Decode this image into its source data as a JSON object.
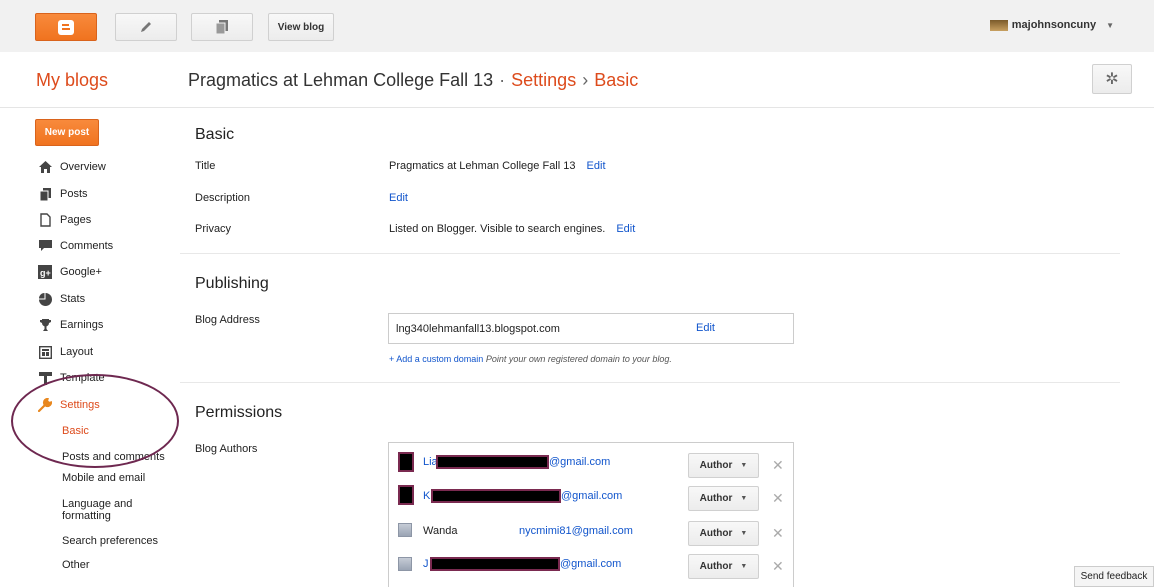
{
  "topbar": {
    "view_blog": "View blog",
    "username": "majohnsoncuny"
  },
  "header": {
    "my_blogs": "My blogs",
    "blog_name": "Pragmatics at Lehman College Fall 13",
    "sep1": "·",
    "settings": "Settings",
    "sep2": "›",
    "basic": "Basic"
  },
  "sidebar": {
    "new_post": "New post",
    "items": [
      {
        "label": "Overview",
        "icon": "home-icon"
      },
      {
        "label": "Posts",
        "icon": "posts-icon"
      },
      {
        "label": "Pages",
        "icon": "pages-icon"
      },
      {
        "label": "Comments",
        "icon": "comments-icon"
      },
      {
        "label": "Google+",
        "icon": "google-plus-icon"
      },
      {
        "label": "Stats",
        "icon": "stats-icon"
      },
      {
        "label": "Earnings",
        "icon": "trophy-icon"
      },
      {
        "label": "Layout",
        "icon": "layout-icon"
      },
      {
        "label": "Template",
        "icon": "template-icon"
      },
      {
        "label": "Settings",
        "icon": "wrench-icon"
      }
    ],
    "sub_items": [
      "Basic",
      "Posts and comments",
      "Mobile and email",
      "Language and formatting",
      "Search preferences",
      "Other"
    ]
  },
  "basic": {
    "title": "Basic",
    "title_label": "Title",
    "title_value": "Pragmatics at Lehman College Fall 13",
    "description_label": "Description",
    "privacy_label": "Privacy",
    "privacy_value": "Listed on Blogger. Visible to search engines.",
    "edit": "Edit"
  },
  "publishing": {
    "title": "Publishing",
    "address_label": "Blog Address",
    "address": "lng340lehmanfall13.blogspot.com",
    "edit": "Edit",
    "add_domain": "+ Add a custom domain",
    "add_domain_hint": "Point your own registered domain to your blog."
  },
  "permissions": {
    "title": "Permissions",
    "authors_label": "Blog Authors",
    "role": "Author",
    "authors": [
      {
        "prefix": "Lia",
        "email": "@gmail.com"
      },
      {
        "prefix": "K",
        "email": "@gmail.com"
      },
      {
        "name": "Wanda",
        "email": "nycmimi81@gmail.com"
      },
      {
        "prefix": "J",
        "email": "@gmail.com"
      }
    ]
  },
  "footer": {
    "send_feedback": "Send feedback"
  },
  "colors": {
    "orange": "#dd4b1c",
    "link": "#1155cc",
    "annotation_circle": "#6e2850"
  }
}
